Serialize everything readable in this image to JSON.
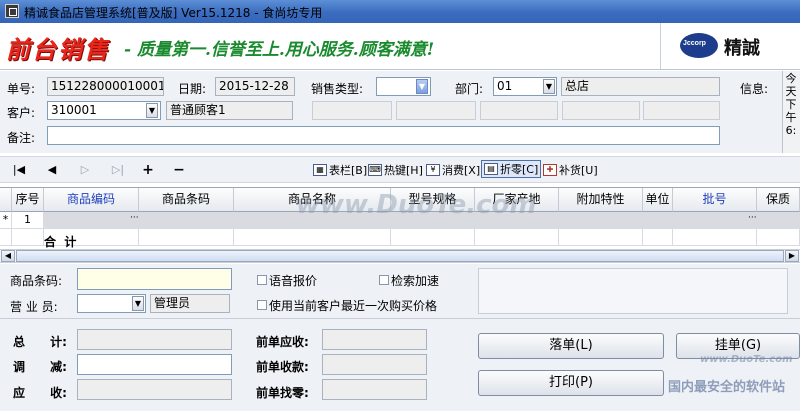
{
  "window": {
    "title": "精诚食品店管理系统[普及版] Ver15.1218  -  食尚坊专用"
  },
  "banner": {
    "title": "前台销售",
    "slogan": "- 质量第一.信誉至上.用心服务.顾客满意!",
    "logo_text": "Jccorp",
    "company": "精誠"
  },
  "form": {
    "order_no_label": "单号:",
    "order_no": "151228000010001",
    "date_label": "日期:",
    "date": "2015-12-28",
    "sale_type_label": "销售类型:",
    "sale_type": "",
    "dept_label": "部门:",
    "dept": "01",
    "dept_name": "总店",
    "info_label": "信息:",
    "customer_label": "客户:",
    "customer": "310001",
    "customer_name": "普通顾客1",
    "remark_label": "备注:",
    "remark": ""
  },
  "side_panel": {
    "text": "今天下午6:"
  },
  "toolbar": {
    "buttons": [
      {
        "label": "表栏[B]",
        "icon": "table-icon"
      },
      {
        "label": "热键[H]",
        "icon": "keyboard-icon"
      },
      {
        "label": "消费[X]",
        "icon": "consume-icon"
      },
      {
        "label": "折零[C]",
        "icon": "discount-icon"
      },
      {
        "label": "补货[U]",
        "icon": "restock-icon"
      }
    ]
  },
  "grid": {
    "columns": [
      "序号",
      "商品编码",
      "商品条码",
      "商品名称",
      "型号规格",
      "厂家产地",
      "附加特性",
      "单位",
      "批号",
      "保质"
    ],
    "rows": [
      {
        "marker": "*",
        "no": "1"
      }
    ],
    "total_label": "合  计"
  },
  "bottom": {
    "barcode_label": "商品条码:",
    "barcode": "",
    "clerk_label": "营 业 员:",
    "clerk": "",
    "clerk_name": "管理员",
    "voice_price": "语音报价",
    "search_speed": "检索加速",
    "use_last_price": "使用当前客户最近一次购买价格",
    "total_label": "总      计:",
    "adjust_label": "调      减:",
    "receivable_label": "应      收:",
    "prev_receivable_label": "前单应收:",
    "prev_received_label": "前单收款:",
    "prev_change_label": "前单找零:",
    "post_button": "落单(L)",
    "hold_button": "挂单(G)",
    "print_button": "打印(P)"
  },
  "watermarks": {
    "center": "www.DuoTe.com",
    "site_sub": "www.DuoTe.com",
    "site_brand": "国内最安全的软件站"
  }
}
